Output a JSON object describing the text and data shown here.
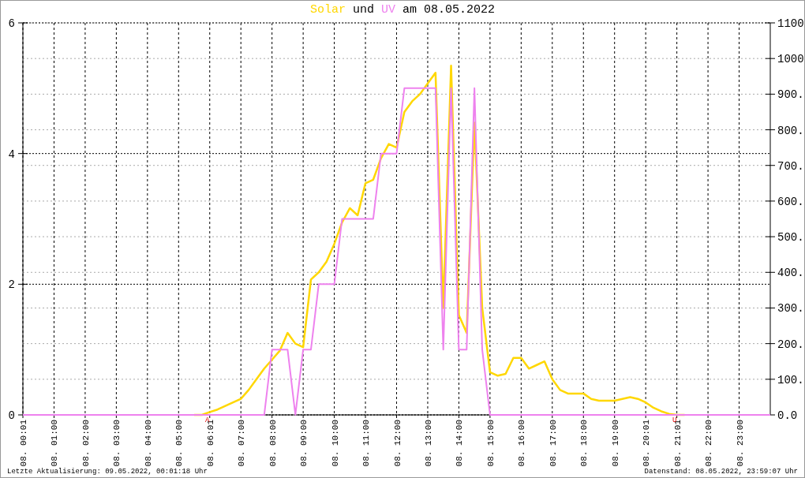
{
  "title_middle": "und",
  "title_end": "am 08.05.2022",
  "chart_data": {
    "type": "line",
    "grid": true,
    "ylim": [
      0,
      6
    ],
    "yticks": [
      0,
      2,
      4,
      6
    ],
    "y2lim": [
      0,
      1100
    ],
    "y2ticks": [
      {
        "value": 0,
        "label": "0.0"
      },
      {
        "value": 100,
        "label": "100."
      },
      {
        "value": 200,
        "label": "200."
      },
      {
        "value": 300,
        "label": "300."
      },
      {
        "value": 400,
        "label": "400."
      },
      {
        "value": 500,
        "label": "500."
      },
      {
        "value": 600,
        "label": "600."
      },
      {
        "value": 700,
        "label": "700."
      },
      {
        "value": 800,
        "label": "800."
      },
      {
        "value": 900,
        "label": "900."
      },
      {
        "value": 1000,
        "label": "1000"
      },
      {
        "value": 1100,
        "label": "1100"
      }
    ],
    "categories": [
      "08. 00:01",
      null,
      null,
      null,
      "08. 01:00",
      null,
      null,
      null,
      "08. 02:00",
      null,
      null,
      null,
      "08. 03:00",
      null,
      null,
      null,
      "08. 04:00",
      null,
      null,
      null,
      "08. 05:00",
      null,
      null,
      null,
      "08. 06:01",
      null,
      null,
      null,
      "08. 07:00",
      null,
      null,
      null,
      "08. 08:00",
      null,
      null,
      null,
      "08. 09:00",
      null,
      null,
      null,
      "08. 10:00",
      null,
      null,
      null,
      "08. 11:00",
      null,
      null,
      null,
      "08. 12:00",
      null,
      null,
      null,
      "08. 13:00",
      null,
      null,
      null,
      "08. 14:00",
      null,
      null,
      null,
      "08. 15:00",
      null,
      null,
      null,
      "08. 16:00",
      null,
      null,
      null,
      "08. 17:00",
      null,
      null,
      null,
      "08. 18:00",
      null,
      null,
      null,
      "08. 19:00",
      null,
      null,
      null,
      "08. 20:01",
      null,
      null,
      null,
      "08. 21:01",
      null,
      null,
      null,
      "08. 22:00",
      null,
      null,
      null,
      "08. 23:00",
      null,
      null,
      null,
      null
    ],
    "series": [
      {
        "name": "Solar",
        "color": "#ffd700",
        "axis": "y2",
        "values": [
          null,
          null,
          null,
          null,
          null,
          null,
          null,
          null,
          null,
          null,
          null,
          null,
          null,
          null,
          null,
          null,
          null,
          null,
          null,
          null,
          null,
          null,
          0,
          0,
          8,
          15,
          25,
          35,
          45,
          70,
          100,
          130,
          155,
          180,
          230,
          200,
          190,
          380,
          400,
          430,
          480,
          540,
          580,
          560,
          650,
          660,
          720,
          760,
          750,
          850,
          880,
          900,
          930,
          960,
          300,
          980,
          280,
          230,
          820,
          300,
          120,
          110,
          115,
          160,
          160,
          130,
          140,
          150,
          100,
          70,
          60,
          60,
          60,
          45,
          40,
          40,
          40,
          45,
          50,
          45,
          35,
          20,
          10,
          3,
          0,
          0,
          null,
          null,
          null,
          null,
          null,
          null,
          null,
          null,
          null,
          null,
          null
        ]
      },
      {
        "name": "UV",
        "color": "#ee82ee",
        "values": [
          0,
          0,
          0,
          0,
          0,
          0,
          0,
          0,
          0,
          0,
          0,
          0,
          0,
          0,
          0,
          0,
          0,
          0,
          0,
          0,
          0,
          0,
          0,
          0,
          0,
          0,
          0,
          0,
          0,
          0,
          0,
          0,
          1,
          1,
          1,
          0,
          1,
          1,
          2,
          2,
          2,
          3,
          3,
          3,
          3,
          3,
          4,
          4,
          4,
          5,
          5,
          5,
          5,
          5,
          1,
          5,
          1,
          1,
          5,
          1,
          0,
          0,
          0,
          0,
          0,
          0,
          0,
          0,
          0,
          0,
          0,
          0,
          0,
          0,
          0,
          0,
          0,
          0,
          0,
          0,
          0,
          0,
          0,
          0,
          0,
          0,
          0,
          0,
          0,
          0,
          0,
          0,
          0,
          0,
          0,
          0,
          0
        ]
      }
    ],
    "annotations": [
      {
        "x": "08. 06:01",
        "y": 0,
        "text": "A"
      },
      {
        "x": "08. 21:01",
        "y": 0,
        "text": "U"
      }
    ]
  },
  "footer_left": "Letzte Aktualisierung: 09.05.2022, 00:01:18 Uhr",
  "footer_right": "Datenstand: 08.05.2022, 23:59:07 Uhr"
}
